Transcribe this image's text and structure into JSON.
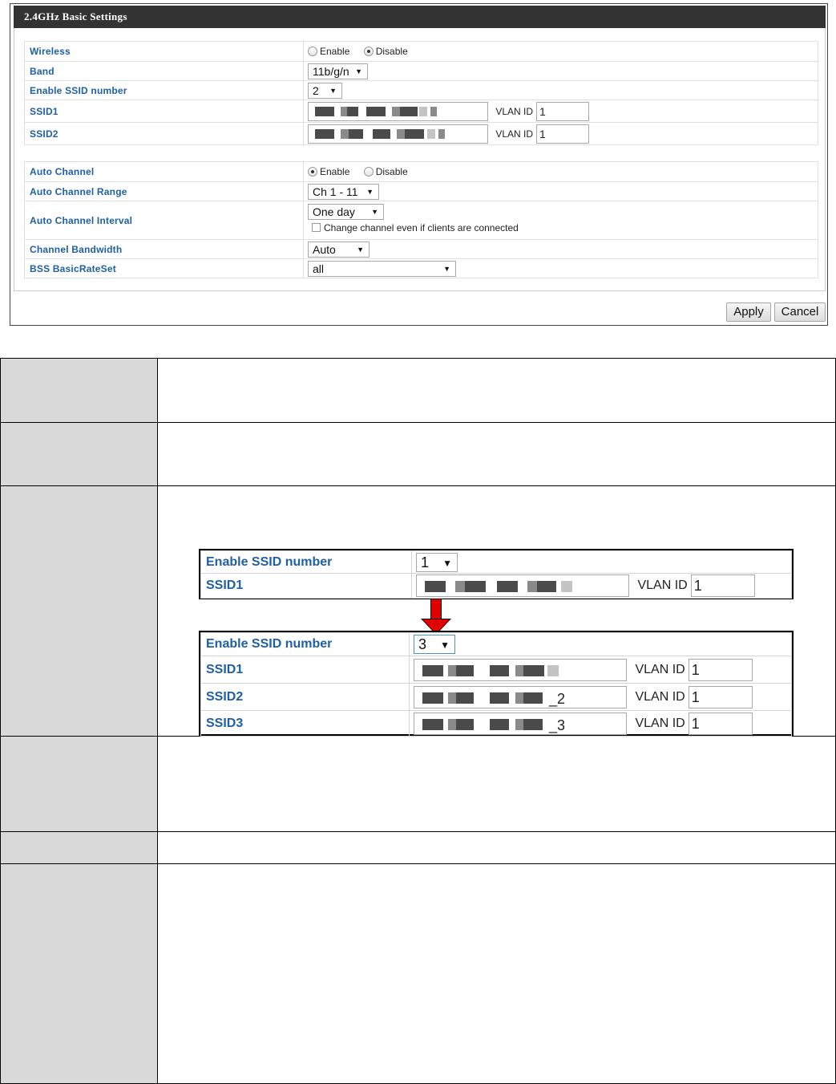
{
  "panel": {
    "title": "2.4GHz Basic Settings",
    "wireless": {
      "label": "Wireless",
      "options": [
        "Enable",
        "Disable"
      ],
      "selected": "Disable"
    },
    "band": {
      "label": "Band",
      "value": "11b/g/n"
    },
    "enable_ssid_number": {
      "label": "Enable SSID number",
      "value": "2"
    },
    "ssids": [
      {
        "label": "SSID1",
        "vlan_label": "VLAN ID",
        "vlan_value": "1"
      },
      {
        "label": "SSID2",
        "vlan_label": "VLAN ID",
        "vlan_value": "1"
      }
    ],
    "auto_channel": {
      "label": "Auto Channel",
      "options": [
        "Enable",
        "Disable"
      ],
      "selected": "Enable"
    },
    "auto_channel_range": {
      "label": "Auto Channel Range",
      "value": "Ch 1 - 11"
    },
    "auto_channel_interval": {
      "label": "Auto Channel Interval",
      "value": "One day",
      "checkbox_label": "Change channel even if clients are connected",
      "checked": false
    },
    "channel_bandwidth": {
      "label": "Channel Bandwidth",
      "value": "Auto"
    },
    "bss_basic_rate_set": {
      "label": "BSS BasicRateSet",
      "value": "all"
    },
    "apply_label": "Apply",
    "cancel_label": "Cancel"
  },
  "inset_before": {
    "enable_ssid_number": {
      "label": "Enable SSID number",
      "value": "1"
    },
    "ssids": [
      {
        "label": "SSID1",
        "suffix": "",
        "vlan_label": "VLAN ID",
        "vlan_value": "1"
      }
    ]
  },
  "inset_after": {
    "enable_ssid_number": {
      "label": "Enable SSID number",
      "value": "3"
    },
    "ssids": [
      {
        "label": "SSID1",
        "suffix": "",
        "vlan_label": "VLAN ID",
        "vlan_value": "1"
      },
      {
        "label": "SSID2",
        "suffix": "_2",
        "vlan_label": "VLAN ID",
        "vlan_value": "1"
      },
      {
        "label": "SSID3",
        "suffix": "_3",
        "vlan_label": "VLAN ID",
        "vlan_value": "1"
      }
    ]
  },
  "colors": {
    "header_bg": "#333333",
    "label_blue": "#1f5fa6",
    "doc_label_bg": "#d9d9d9",
    "arrow": "#e00000"
  },
  "icons": [
    "radio-icon",
    "dropdown-arrow-icon",
    "checkbox-icon",
    "down-arrow-icon"
  ]
}
